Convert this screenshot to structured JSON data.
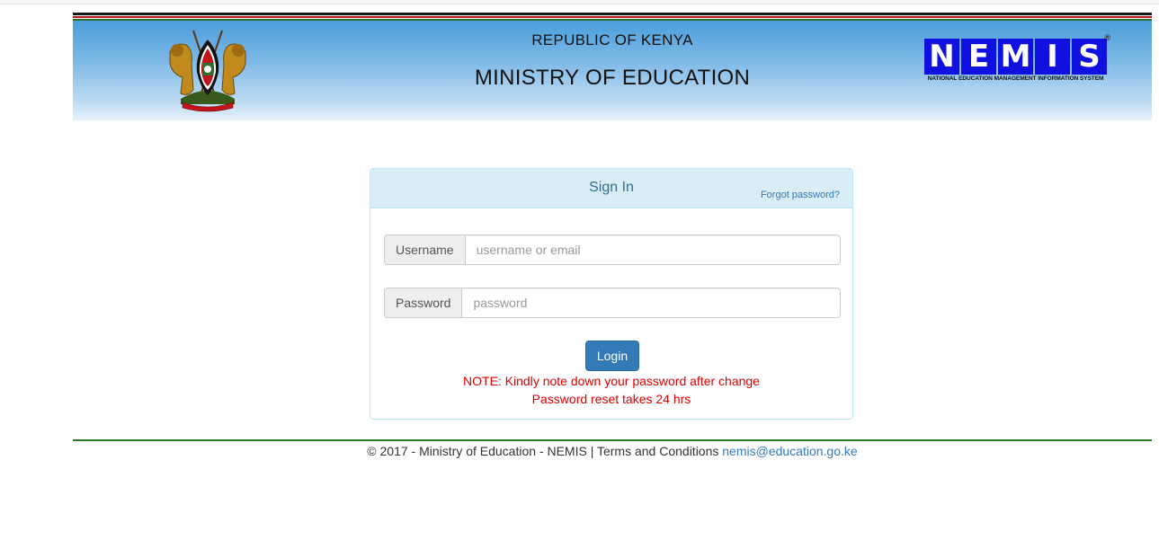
{
  "header": {
    "country": "REPUBLIC OF KENYA",
    "ministry": "MINISTRY OF EDUCATION",
    "coat_of_arms_motto": "HARAMBEE",
    "logo": {
      "letters": [
        "N",
        "E",
        "M",
        "I",
        "S"
      ],
      "registered_mark": "®",
      "subtitle": "NATIONAL EDUCATION MANAGEMENT INFORMATION SYSTEM",
      "color": "#1010e0"
    },
    "flag_stripes": [
      "#1a1a1a",
      "#c0151b",
      "#2d6e2d"
    ]
  },
  "signin": {
    "title": "Sign In",
    "forgot_label": "Forgot password?",
    "username_label": "Username",
    "username_placeholder": "username or email",
    "username_value": "",
    "password_label": "Password",
    "password_placeholder": "password",
    "password_value": "",
    "login_label": "Login",
    "note_line1": "NOTE: Kindly note down your password after change",
    "note_line2": "Password reset takes 24 hrs"
  },
  "footer": {
    "text": "© 2017 - Ministry of Education - NEMIS | Terms and Conditions ",
    "email": "nemis@education.go.ke"
  },
  "colors": {
    "primary": "#337ab7",
    "panel_header": "#d9edf7",
    "note": "#e00000",
    "footer_line": "#2a7a2a"
  }
}
